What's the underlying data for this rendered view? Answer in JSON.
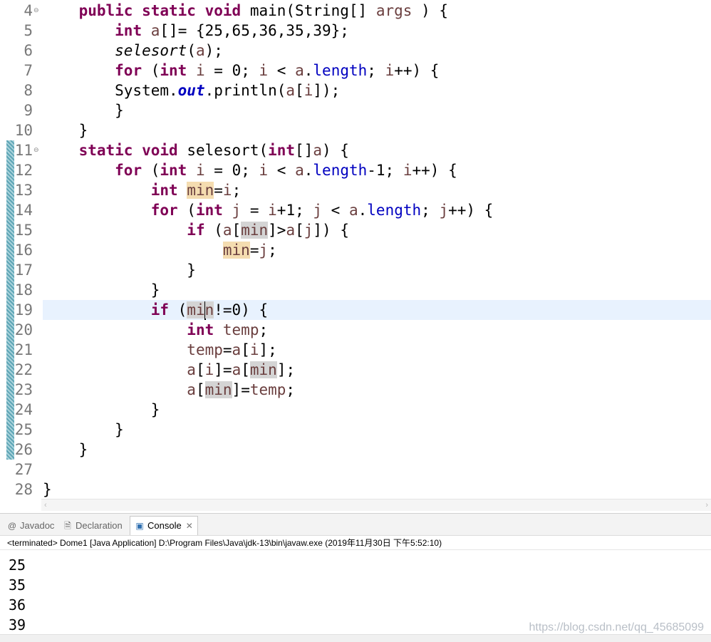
{
  "editor": {
    "lines": [
      {
        "num": "4",
        "fold": "⊖",
        "tokens": [
          [
            "",
            "    "
          ],
          [
            "k",
            "public"
          ],
          [
            "",
            " "
          ],
          [
            "k",
            "static"
          ],
          [
            "",
            " "
          ],
          [
            "k",
            "void"
          ],
          [
            "",
            " main(String[] "
          ],
          [
            "v",
            "args"
          ],
          [
            "",
            " ) {"
          ]
        ]
      },
      {
        "num": "5",
        "tokens": [
          [
            "",
            "        "
          ],
          [
            "k",
            "int"
          ],
          [
            "",
            " "
          ],
          [
            "v",
            "a"
          ],
          [
            "",
            "[]= {25,65,36,35,39};"
          ]
        ]
      },
      {
        "num": "6",
        "tokens": [
          [
            "",
            "        "
          ],
          [
            "m",
            "selesort"
          ],
          [
            "",
            "("
          ],
          [
            "v",
            "a"
          ],
          [
            "",
            ");"
          ]
        ]
      },
      {
        "num": "7",
        "tokens": [
          [
            "",
            "        "
          ],
          [
            "k",
            "for"
          ],
          [
            "",
            " ("
          ],
          [
            "k",
            "int"
          ],
          [
            "",
            " "
          ],
          [
            "v",
            "i"
          ],
          [
            "",
            " = 0; "
          ],
          [
            "v",
            "i"
          ],
          [
            "",
            " < "
          ],
          [
            "v",
            "a"
          ],
          [
            "",
            "."
          ],
          [
            "f",
            "length"
          ],
          [
            "",
            "; "
          ],
          [
            "v",
            "i"
          ],
          [
            "",
            "++) {"
          ]
        ]
      },
      {
        "num": "8",
        "tokens": [
          [
            "",
            "        System."
          ],
          [
            "s",
            "out"
          ],
          [
            "",
            ".println("
          ],
          [
            "v",
            "a"
          ],
          [
            "",
            "["
          ],
          [
            "v",
            "i"
          ],
          [
            "",
            "]);"
          ]
        ]
      },
      {
        "num": "9",
        "tokens": [
          [
            "",
            "        }"
          ]
        ]
      },
      {
        "num": "10",
        "tokens": [
          [
            "",
            "    }"
          ]
        ]
      },
      {
        "num": "11",
        "fold": "⊖",
        "tokens": [
          [
            "",
            "    "
          ],
          [
            "k",
            "static"
          ],
          [
            "",
            " "
          ],
          [
            "k",
            "void"
          ],
          [
            "",
            " selesort("
          ],
          [
            "k",
            "int"
          ],
          [
            "",
            "[]"
          ],
          [
            "v",
            "a"
          ],
          [
            "",
            ") {"
          ]
        ]
      },
      {
        "num": "12",
        "tokens": [
          [
            "",
            "        "
          ],
          [
            "k",
            "for"
          ],
          [
            "",
            " ("
          ],
          [
            "k",
            "int"
          ],
          [
            "",
            " "
          ],
          [
            "v",
            "i"
          ],
          [
            "",
            " = 0; "
          ],
          [
            "v",
            "i"
          ],
          [
            "",
            " < "
          ],
          [
            "v",
            "a"
          ],
          [
            "",
            "."
          ],
          [
            "f",
            "length"
          ],
          [
            "",
            "-1; "
          ],
          [
            "v",
            "i"
          ],
          [
            "",
            "++) {"
          ]
        ]
      },
      {
        "num": "13",
        "tokens": [
          [
            "",
            "            "
          ],
          [
            "k",
            "int"
          ],
          [
            "",
            " "
          ],
          [
            "v occw",
            "min"
          ],
          [
            "",
            "="
          ],
          [
            "v",
            "i"
          ],
          [
            "",
            ";"
          ]
        ]
      },
      {
        "num": "14",
        "tokens": [
          [
            "",
            "            "
          ],
          [
            "k",
            "for"
          ],
          [
            "",
            " ("
          ],
          [
            "k",
            "int"
          ],
          [
            "",
            " "
          ],
          [
            "v",
            "j"
          ],
          [
            "",
            " = "
          ],
          [
            "v",
            "i"
          ],
          [
            "",
            "+1; "
          ],
          [
            "v",
            "j"
          ],
          [
            "",
            " < "
          ],
          [
            "v",
            "a"
          ],
          [
            "",
            "."
          ],
          [
            "f",
            "length"
          ],
          [
            "",
            "; "
          ],
          [
            "v",
            "j"
          ],
          [
            "",
            "++) {"
          ]
        ]
      },
      {
        "num": "15",
        "tokens": [
          [
            "",
            "                "
          ],
          [
            "k",
            "if"
          ],
          [
            "",
            " ("
          ],
          [
            "v",
            "a"
          ],
          [
            "",
            "["
          ],
          [
            "v occr",
            "min"
          ],
          [
            "",
            "]>"
          ],
          [
            "v",
            "a"
          ],
          [
            "",
            "["
          ],
          [
            "v",
            "j"
          ],
          [
            "",
            "]) {"
          ]
        ]
      },
      {
        "num": "16",
        "tokens": [
          [
            "",
            "                    "
          ],
          [
            "v occw",
            "min"
          ],
          [
            "",
            "="
          ],
          [
            "v",
            "j"
          ],
          [
            "",
            ";"
          ]
        ]
      },
      {
        "num": "17",
        "tokens": [
          [
            "",
            "                }"
          ]
        ]
      },
      {
        "num": "18",
        "tokens": [
          [
            "",
            "            }"
          ]
        ]
      },
      {
        "num": "19",
        "current": true,
        "tokens": [
          [
            "",
            "            "
          ],
          [
            "k",
            "if"
          ],
          [
            "",
            " ("
          ],
          [
            "v occr",
            "mi"
          ],
          [
            "caret",
            ""
          ],
          [
            "v occr",
            "n"
          ],
          [
            "",
            "!=0) {"
          ]
        ]
      },
      {
        "num": "20",
        "tokens": [
          [
            "",
            "                "
          ],
          [
            "k",
            "int"
          ],
          [
            "",
            " "
          ],
          [
            "v",
            "temp"
          ],
          [
            "",
            ";"
          ]
        ]
      },
      {
        "num": "21",
        "tokens": [
          [
            "",
            "                "
          ],
          [
            "v",
            "temp"
          ],
          [
            "",
            "="
          ],
          [
            "v",
            "a"
          ],
          [
            "",
            "["
          ],
          [
            "v",
            "i"
          ],
          [
            "",
            "];"
          ]
        ]
      },
      {
        "num": "22",
        "tokens": [
          [
            "",
            "                "
          ],
          [
            "v",
            "a"
          ],
          [
            "",
            "["
          ],
          [
            "v",
            "i"
          ],
          [
            "",
            "]="
          ],
          [
            "v",
            "a"
          ],
          [
            "",
            "["
          ],
          [
            "v occr",
            "min"
          ],
          [
            "",
            "];"
          ]
        ]
      },
      {
        "num": "23",
        "tokens": [
          [
            "",
            "                "
          ],
          [
            "v",
            "a"
          ],
          [
            "",
            "["
          ],
          [
            "v occr",
            "min"
          ],
          [
            "",
            "]="
          ],
          [
            "v",
            "temp"
          ],
          [
            "",
            ";"
          ]
        ]
      },
      {
        "num": "24",
        "tokens": [
          [
            "",
            "            }"
          ]
        ]
      },
      {
        "num": "25",
        "tokens": [
          [
            "",
            "        }"
          ]
        ]
      },
      {
        "num": "26",
        "tokens": [
          [
            "",
            "    }"
          ]
        ]
      },
      {
        "num": "27",
        "tokens": [
          [
            "",
            ""
          ]
        ]
      },
      {
        "num": "28",
        "tokens": [
          [
            "",
            "}"
          ]
        ]
      }
    ]
  },
  "panel": {
    "tabs": [
      {
        "label": "Javadoc",
        "icon": "@",
        "icon_name": "javadoc-icon"
      },
      {
        "label": "Declaration",
        "icon": "🗎",
        "icon_name": "declaration-icon"
      },
      {
        "label": "Console",
        "icon": "▣",
        "icon_name": "console-icon",
        "active": true,
        "close": "✕"
      }
    ],
    "status": "<terminated> Dome1 [Java Application] D:\\Program Files\\Java\\jdk-13\\bin\\javaw.exe (2019年11月30日 下午5:52:10)",
    "output": [
      "25",
      "35",
      "36",
      "39"
    ],
    "watermark": "https://blog.csdn.net/qq_45685099"
  }
}
